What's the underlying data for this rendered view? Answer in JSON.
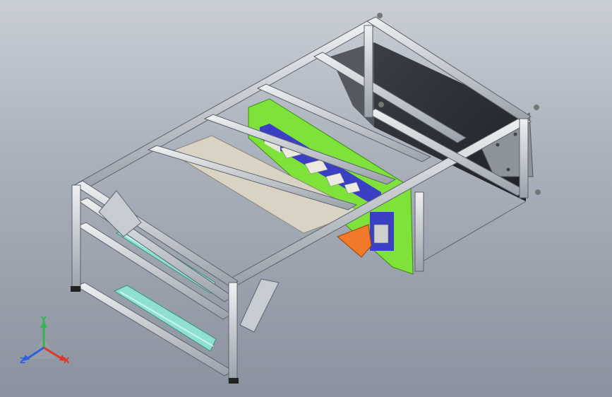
{
  "triad": {
    "x_label": "X",
    "y_label": "Y",
    "z_label": "Z"
  },
  "colors": {
    "background_top": "#c9ced6",
    "background_bottom": "#8a929f",
    "frame": "#d7dbe0",
    "frame_shadow": "#6f7680",
    "panel_back": "#2c2f35",
    "plate_green": "#7ee23a",
    "rail_blue": "#3b3fc4",
    "belt": "#d9d3c4",
    "pipe": "#8fe0d2",
    "hopper": "#f07a2a",
    "axis_x": "#e0352b",
    "axis_y": "#2db84a",
    "axis_z": "#2f5fe0"
  }
}
